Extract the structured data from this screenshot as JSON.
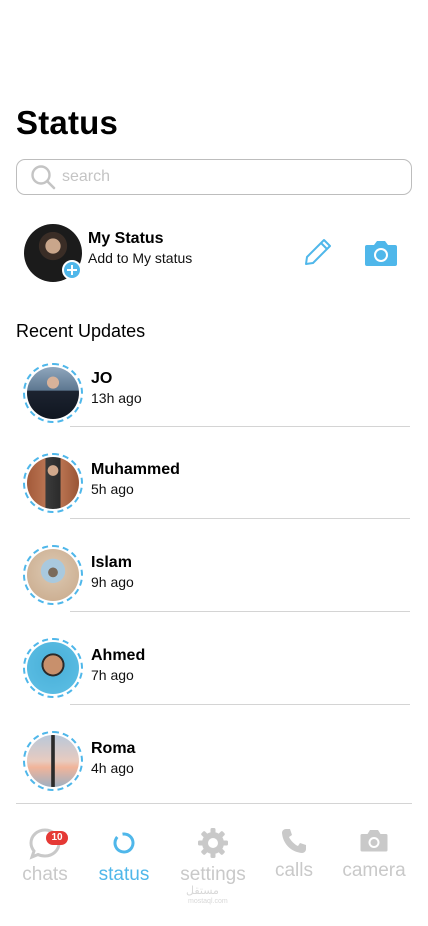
{
  "header": {
    "title": "Status"
  },
  "search": {
    "placeholder": "search",
    "value": ""
  },
  "my_status": {
    "name": "My Status",
    "subtitle": "Add to My status"
  },
  "recent": {
    "title": "Recent Updates",
    "items": [
      {
        "name": "JO",
        "time": "13h ago"
      },
      {
        "name": "Muhammed",
        "time": "5h ago"
      },
      {
        "name": "Islam",
        "time": "9h ago"
      },
      {
        "name": "Ahmed",
        "time": "7h ago"
      },
      {
        "name": "Roma",
        "time": "4h ago"
      }
    ]
  },
  "tabbar": {
    "chats": {
      "label": "chats",
      "badge": "10"
    },
    "status": {
      "label": "status"
    },
    "settings": {
      "label": "settings"
    },
    "calls": {
      "label": "calls"
    },
    "camera": {
      "label": "camera"
    }
  },
  "watermark": {
    "text": "مستقل",
    "sub": "mostaql.com"
  },
  "colors": {
    "accent": "#4fb7ea",
    "muted": "#c9c9c9",
    "badge": "#e53935"
  },
  "icons": [
    "search-icon",
    "add-icon",
    "pencil-icon",
    "camera-icon",
    "chat-icon",
    "status-icon",
    "settings-icon",
    "phone-icon",
    "camera-tab-icon"
  ]
}
